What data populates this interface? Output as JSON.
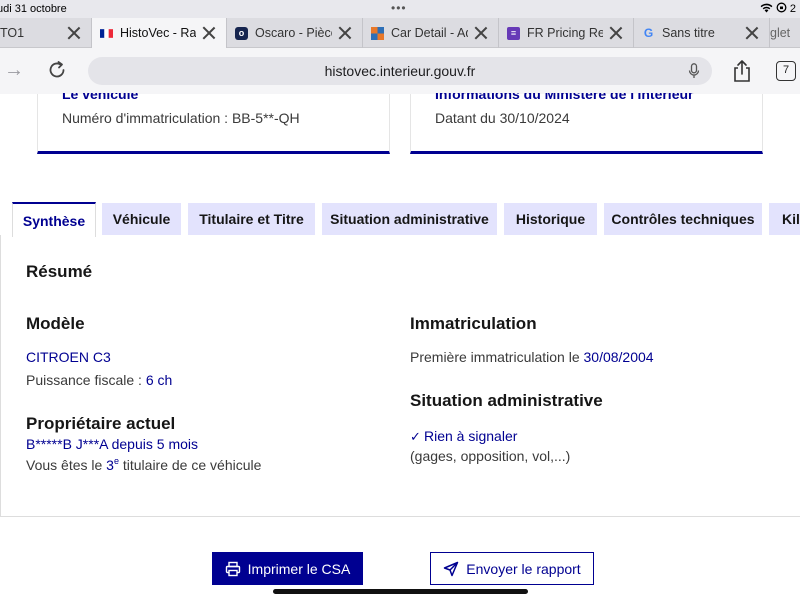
{
  "status_bar": {
    "date": "udi 31 octobre",
    "battery_text": "2"
  },
  "browser": {
    "tabs": [
      {
        "title": "TO1",
        "favicon": "none",
        "active": false
      },
      {
        "title": "HistoVec - Rapp",
        "favicon": "french-flag-icon",
        "active": true
      },
      {
        "title": "Oscaro - Pièce",
        "favicon": "oscaro-icon",
        "active": false
      },
      {
        "title": "Car Detail - Adr",
        "favicon": "car-detail-icon",
        "active": false
      },
      {
        "title": "FR Pricing Requ",
        "favicon": "forms-icon",
        "active": false
      },
      {
        "title": "Sans titre",
        "favicon": "google-icon",
        "active": false
      },
      {
        "title": "glet",
        "favicon": "none",
        "active": false
      }
    ],
    "url": "histovec.interieur.gouv.fr",
    "tab_count": "7"
  },
  "cards": {
    "vehicle": {
      "title": "Le véhicule",
      "text": "Numéro d'immatriculation : BB-5**-QH"
    },
    "ministry": {
      "title": "Informations du Ministère de l'Intérieur",
      "text": "Datant du 30/10/2024"
    }
  },
  "report_tabs": [
    {
      "label": "Synthèse",
      "selected": true
    },
    {
      "label": "Véhicule",
      "selected": false
    },
    {
      "label": "Titulaire et Titre",
      "selected": false
    },
    {
      "label": "Situation administrative",
      "selected": false
    },
    {
      "label": "Historique",
      "selected": false
    },
    {
      "label": "Contrôles techniques",
      "selected": false
    },
    {
      "label": "Kilo",
      "selected": false
    }
  ],
  "summary": {
    "heading": "Résumé",
    "model": {
      "heading": "Modèle",
      "name": "CITROEN C3",
      "power_label": "Puissance fiscale : ",
      "power_value": "6 ch"
    },
    "owner": {
      "heading": "Propriétaire actuel",
      "name": "B*****B J***A",
      "since_label": " depuis ",
      "since_value": "5 mois",
      "rank_prefix": "Vous êtes le ",
      "rank_number": "3",
      "rank_sup": "e",
      "rank_suffix": " titulaire de ce véhicule"
    },
    "registration": {
      "heading": "Immatriculation",
      "first_label": "Première immatriculation le ",
      "first_date": "30/08/2004"
    },
    "admin": {
      "heading": "Situation administrative",
      "status": "Rien à signaler",
      "details": "(gages, opposition, vol,...)"
    }
  },
  "actions": {
    "print_label": "Imprimer le CSA",
    "send_label": "Envoyer le rapport"
  },
  "colors": {
    "brand_blue": "#000091",
    "tab_bg": "#e3e3fd"
  }
}
